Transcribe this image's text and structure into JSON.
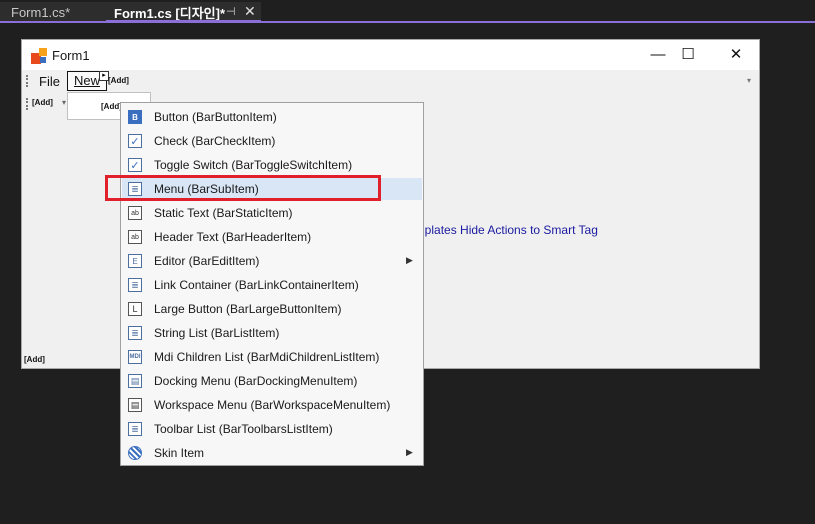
{
  "tabs": {
    "inactive": "Form1.cs*",
    "active": "Form1.cs [디자인]*",
    "pin_glyph": "⊣",
    "close_glyph": "✕"
  },
  "form": {
    "title": "Form1",
    "window_buttons": {
      "minimize": "—",
      "maximize": "☐",
      "close": "✕"
    },
    "menubar": {
      "file": "File",
      "new": "New",
      "add_next": "[Add]",
      "dropdown_glyph": "▾"
    },
    "toolbar_add": "[Add]",
    "subpopup_add": "[Add]",
    "bottom_add": "[Add]",
    "hint": "nplates  Hide Actions to Smart Tag"
  },
  "menu": {
    "items": [
      {
        "label": "Button (BarButtonItem)",
        "icon": "button-icon",
        "glyph": "B"
      },
      {
        "label": "Check (BarCheckItem)",
        "icon": "check-icon",
        "glyph": "✓"
      },
      {
        "label": "Toggle Switch (BarToggleSwitchItem)",
        "icon": "toggle-icon",
        "glyph": "✓"
      },
      {
        "label": "Menu (BarSubItem)",
        "icon": "menu-icon",
        "glyph": "≣"
      },
      {
        "label": "Static Text (BarStaticItem)",
        "icon": "static-text-icon",
        "glyph": "ab"
      },
      {
        "label": "Header Text (BarHeaderItem)",
        "icon": "header-text-icon",
        "glyph": "ab"
      },
      {
        "label": "Editor (BarEditItem)",
        "icon": "editor-icon",
        "glyph": "E",
        "submenu": "▶"
      },
      {
        "label": "Link Container (BarLinkContainerItem)",
        "icon": "link-container-icon",
        "glyph": "≣"
      },
      {
        "label": "Large Button (BarLargeButtonItem)",
        "icon": "large-button-icon",
        "glyph": "L"
      },
      {
        "label": "String List (BarListItem)",
        "icon": "string-list-icon",
        "glyph": "≣"
      },
      {
        "label": "Mdi Children List (BarMdiChildrenListItem)",
        "icon": "mdi-list-icon",
        "glyph": "MDI"
      },
      {
        "label": "Docking Menu (BarDockingMenuItem)",
        "icon": "docking-menu-icon",
        "glyph": "▤"
      },
      {
        "label": "Workspace Menu (BarWorkspaceMenuItem)",
        "icon": "workspace-menu-icon",
        "glyph": "▤"
      },
      {
        "label": "Toolbar List (BarToolbarsListItem)",
        "icon": "toolbar-list-icon",
        "glyph": "≣"
      },
      {
        "label": "Skin Item",
        "icon": "skin-icon",
        "glyph": "",
        "submenu": "▶"
      }
    ],
    "highlighted_index": 3,
    "highlight_color": "#d9e6f6",
    "annotation_color": "#e0202a"
  }
}
